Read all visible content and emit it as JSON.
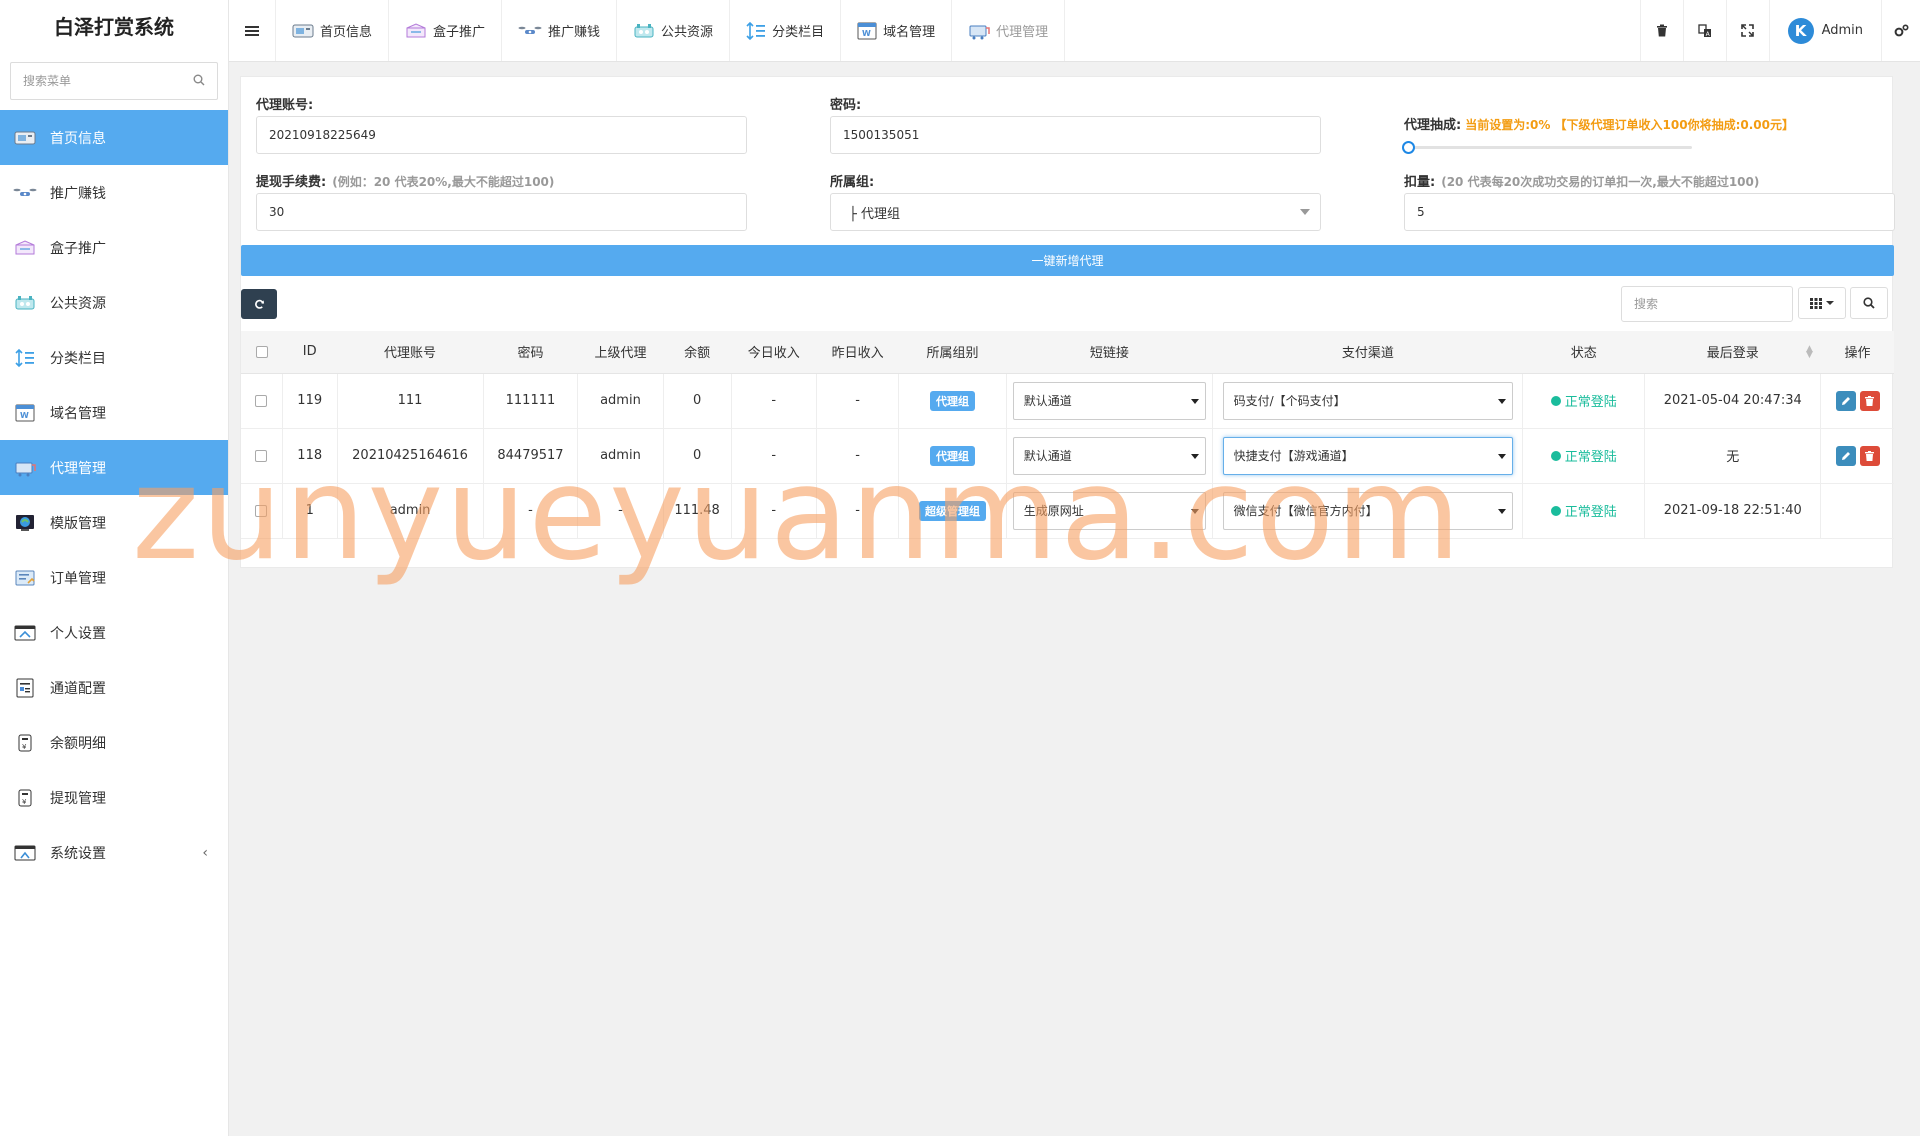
{
  "sidebar": {
    "brand": "白泽打赏系统",
    "search_placeholder": "搜索菜单",
    "items": [
      {
        "label": "首页信息",
        "icon": "dashboard-icon",
        "active": true
      },
      {
        "label": "推广赚钱",
        "icon": "drone-icon",
        "active": false
      },
      {
        "label": "盒子推广",
        "icon": "box-icon",
        "active": false
      },
      {
        "label": "公共资源",
        "icon": "resource-icon",
        "active": false
      },
      {
        "label": "分类栏目",
        "icon": "list-icon",
        "active": false
      },
      {
        "label": "域名管理",
        "icon": "domain-icon",
        "active": false
      },
      {
        "label": "代理管理",
        "icon": "agent-icon",
        "active": true
      },
      {
        "label": "模版管理",
        "icon": "template-icon",
        "active": false
      },
      {
        "label": "订单管理",
        "icon": "order-icon",
        "active": false
      },
      {
        "label": "个人设置",
        "icon": "profile-icon",
        "active": false
      },
      {
        "label": "通道配置",
        "icon": "channel-icon",
        "active": false
      },
      {
        "label": "余额明细",
        "icon": "balance-icon",
        "active": false
      },
      {
        "label": "提现管理",
        "icon": "withdraw-icon",
        "active": false
      },
      {
        "label": "系统设置",
        "icon": "settings-icon",
        "active": false
      }
    ]
  },
  "topbar": {
    "tabs": [
      {
        "label": "首页信息",
        "icon": "dashboard-icon"
      },
      {
        "label": "盒子推广",
        "icon": "box-icon"
      },
      {
        "label": "推广赚钱",
        "icon": "drone-icon"
      },
      {
        "label": "公共资源",
        "icon": "resource-icon"
      },
      {
        "label": "分类栏目",
        "icon": "list-icon"
      },
      {
        "label": "域名管理",
        "icon": "domain-icon"
      },
      {
        "label": "代理管理",
        "icon": "agent-icon"
      }
    ],
    "admin_label": "Admin",
    "admin_logo_letter": "K"
  },
  "form": {
    "account_label": "代理账号:",
    "account_value": "20210918225649",
    "password_label": "密码:",
    "password_value": "1500135051",
    "commission_label": "代理抽成:",
    "commission_hint": "当前设置为:0% 【下级代理订单收入100你将抽成:0.00元】",
    "commission_percent": 0,
    "fee_label": "提现手续费:",
    "fee_hint": "(例如：20 代表20%,最大不能超过100)",
    "fee_value": "30",
    "group_label": "所属组:",
    "group_value": "├ 代理组",
    "deduct_label": "扣量:",
    "deduct_hint": "(20 代表每20次成功交易的订单扣一次,最大不能超过100)",
    "deduct_value": "5",
    "add_button": "一键新增代理"
  },
  "toolbar": {
    "search_placeholder": "搜索"
  },
  "table": {
    "headers": [
      "ID",
      "代理账号",
      "密码",
      "上级代理",
      "余额",
      "今日收入",
      "昨日收入",
      "所属组别",
      "短链接",
      "支付渠道",
      "状态",
      "最后登录",
      "操作"
    ],
    "rows": [
      {
        "id": "119",
        "account": "111",
        "password": "111111",
        "parent": "admin",
        "balance": "0",
        "today": "-",
        "yesterday": "-",
        "group": "代理组",
        "shortlink": "默认通道",
        "channel": "码支付/【个码支付】",
        "status": "正常登陆",
        "last_login": "2021-05-04 20:47:34",
        "has_actions": true
      },
      {
        "id": "118",
        "account": "20210425164616",
        "password": "84479517",
        "parent": "admin",
        "balance": "0",
        "today": "-",
        "yesterday": "-",
        "group": "代理组",
        "shortlink": "默认通道",
        "channel": "快捷支付【游戏通道】",
        "status": "正常登陆",
        "last_login": "无",
        "has_actions": true
      },
      {
        "id": "1",
        "account": "admin",
        "password": "-",
        "parent": "-",
        "balance": "111.48",
        "today": "-",
        "yesterday": "-",
        "group": "超级管理组",
        "shortlink": "生成原网址",
        "channel": "微信支付【微信官方内付】",
        "status": "正常登陆",
        "last_login": "2021-09-18 22:51:40",
        "has_actions": false
      }
    ]
  },
  "watermark": "zunyueyuanma.com",
  "colors": {
    "accent": "#55aaef",
    "dark_button": "#2f4050",
    "status_green": "#1abc9c",
    "hint_orange": "#f39c12",
    "danger": "#dd4b39"
  }
}
